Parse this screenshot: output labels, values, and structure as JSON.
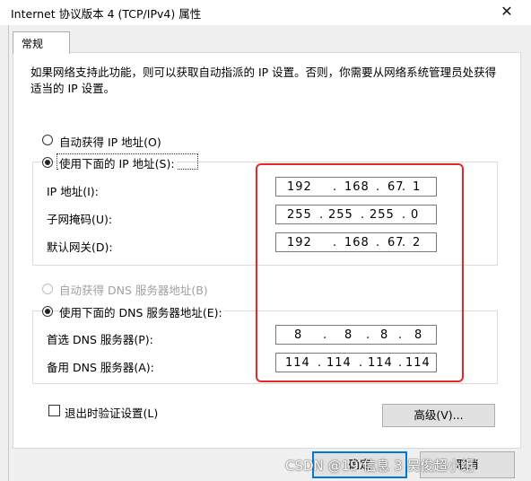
{
  "window": {
    "title": "Internet 协议版本 4 (TCP/IPv4) 属性",
    "close_glyph": "✕"
  },
  "tabs": [
    {
      "label": "常规"
    }
  ],
  "description": "如果网络支持此功能，则可以获取自动指派的 IP 设置。否则，你需要从网络系统管理员处获得适当的 IP 设置。",
  "ip_mode": {
    "auto_label": "自动获得 IP 地址(O)",
    "manual_label": "使用下面的 IP 地址(S):",
    "selected": "manual"
  },
  "ip_fields": [
    {
      "label": "IP 地址(I):",
      "octets": [
        "192",
        "168",
        "67",
        "1"
      ]
    },
    {
      "label": "子网掩码(U):",
      "octets": [
        "255",
        "255",
        "255",
        "0"
      ]
    },
    {
      "label": "默认网关(D):",
      "octets": [
        "192",
        "168",
        "67",
        "2"
      ]
    }
  ],
  "dns_mode": {
    "auto_label": "自动获得 DNS 服务器地址(B)",
    "manual_label": "使用下面的 DNS 服务器地址(E):",
    "selected": "manual"
  },
  "dns_fields": [
    {
      "label": "首选 DNS 服务器(P):",
      "octets": [
        "8",
        "8",
        "8",
        "8"
      ]
    },
    {
      "label": "备用 DNS 服务器(A):",
      "octets": [
        "114",
        "114",
        "114",
        "114"
      ]
    }
  ],
  "validate_on_exit": {
    "label": "退出时验证设置(L)",
    "checked": false
  },
  "buttons": {
    "advanced": "高级(V)...",
    "ok": "确定",
    "cancel": "取消"
  },
  "watermark": "CSDN @19 信息 3 吴俊超小组",
  "colors": {
    "annotation": "#e8262c",
    "focus": "#0078d7"
  }
}
